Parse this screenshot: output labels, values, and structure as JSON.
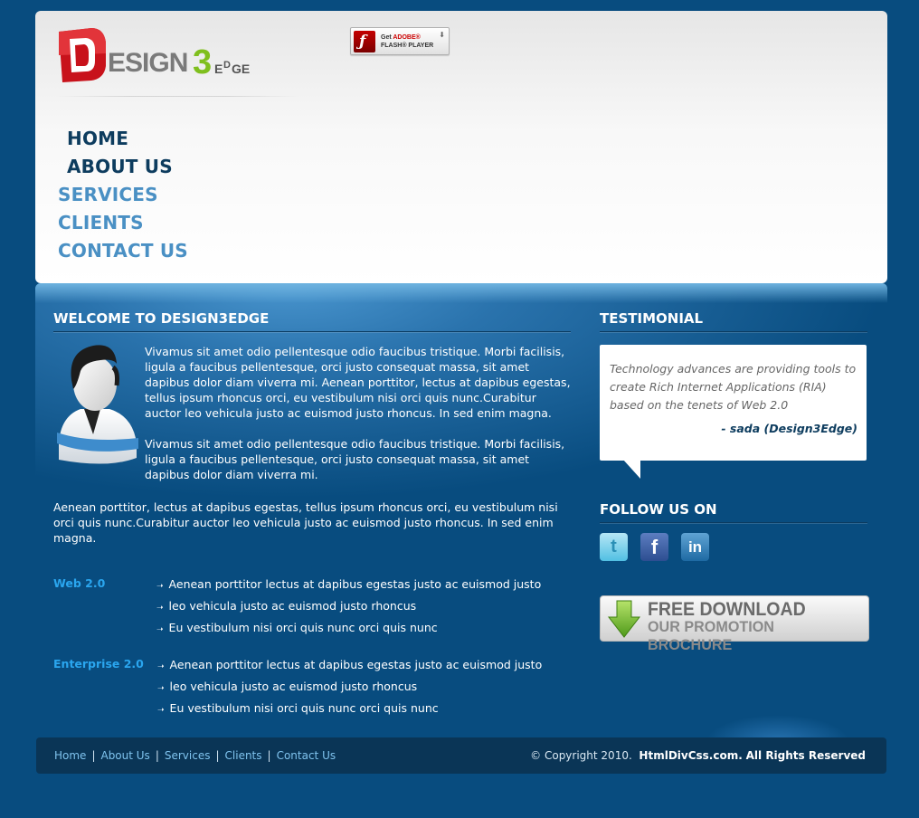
{
  "header": {
    "logo_text": "DESIGN3EDGE",
    "flash_badge": {
      "line1_prefix": "Get ",
      "line1_brand": "ADOBE®",
      "line2": "FLASH® PLAYER"
    },
    "nav": [
      {
        "label": "HOME",
        "active": true
      },
      {
        "label": "ABOUT US",
        "active": true
      },
      {
        "label": "SERVICES",
        "active": false
      },
      {
        "label": "CLIENTS",
        "active": false
      },
      {
        "label": "CONTACT US",
        "active": false
      }
    ]
  },
  "main": {
    "title": "WELCOME TO DESIGN3EDGE",
    "para1": "Vivamus sit amet odio pellentesque odio faucibus tristique. Morbi facilisis, ligula a faucibus pellentesque, orci justo consequat massa, sit amet dapibus dolor diam viverra mi. Aenean porttitor, lectus at dapibus egestas, tellus ipsum rhoncus orci, eu vestibulum nisi orci quis nunc.Curabitur auctor leo vehicula justo ac euismod justo rhoncus. In sed enim magna.",
    "para2": "Vivamus sit amet odio pellentesque odio faucibus tristique. Morbi facilisis, ligula a faucibus pellentesque, orci justo consequat massa, sit amet dapibus dolor diam viverra mi.",
    "para3": "Aenean porttitor, lectus at dapibus egestas, tellus ipsum rhoncus orci, eu vestibulum nisi orci quis nunc.Curabitur auctor leo vehicula justo ac euismod justo rhoncus. In sed enim magna.",
    "lists": [
      {
        "label": "Web 2.0",
        "items": [
          "Aenean porttitor lectus at dapibus egestas justo ac euismod justo",
          "leo vehicula justo ac euismod justo rhoncus",
          "Eu vestibulum nisi orci quis nunc orci quis nunc"
        ]
      },
      {
        "label": "Enterprise 2.0",
        "items": [
          "Aenean porttitor lectus at dapibus egestas justo ac euismod justo",
          "leo vehicula justo ac euismod justo rhoncus",
          "Eu vestibulum nisi orci quis nunc orci quis nunc"
        ]
      }
    ]
  },
  "sidebar": {
    "testimonial_title": "TESTIMONIAL",
    "testimonial_quote": "Technology advances are providing tools to create Rich Internet Applications (RIA) based on the tenets of Web 2.0",
    "testimonial_author": "- sada (Design3Edge)",
    "follow_title": "FOLLOW US ON",
    "social": [
      {
        "name": "twitter",
        "glyph": "t"
      },
      {
        "name": "facebook",
        "glyph": "f"
      },
      {
        "name": "linkedin",
        "glyph": "in"
      }
    ],
    "download": {
      "line1": "FREE DOWNLOAD",
      "line2": "OUR PROMOTION BROCHURE"
    }
  },
  "footer": {
    "links": [
      "Home",
      "About Us",
      "Services",
      "Clients",
      "Contact Us"
    ],
    "copyright_prefix": "© Copyright 2010.",
    "copyright_site": "HtmlDivCss.com.",
    "copyright_suffix": "All Rights Reserved"
  },
  "colors": {
    "page_bg": "#084c7f",
    "nav_active": "#0d3c5e",
    "nav_inactive": "#4a90c4",
    "accent_label": "#2aa6ef",
    "footer_bg": "#0a3556"
  }
}
